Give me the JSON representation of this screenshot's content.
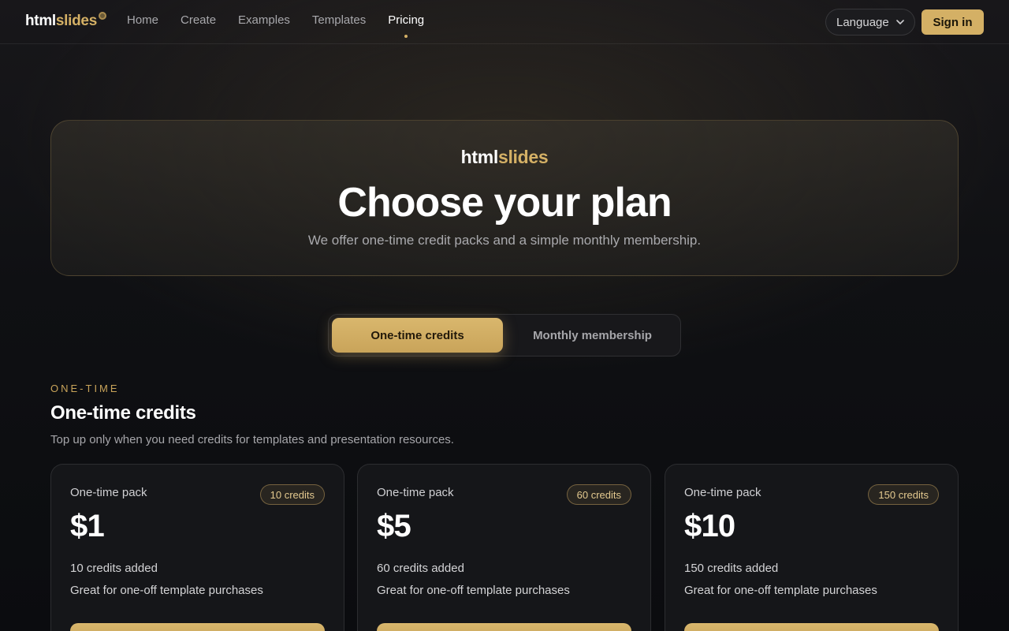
{
  "nav": {
    "brand_a": "html",
    "brand_b": "slides",
    "links": [
      "Home",
      "Create",
      "Examples",
      "Templates",
      "Pricing"
    ],
    "active": "Pricing",
    "language_label": "Language",
    "signin_label": "Sign in"
  },
  "hero": {
    "brand_a": "html",
    "brand_b": "slides",
    "title": "Choose your plan",
    "subtitle": "We offer one-time credit packs and a simple monthly membership."
  },
  "toggle": {
    "options": [
      "One-time credits",
      "Monthly membership"
    ],
    "selected": "One-time credits"
  },
  "section": {
    "eyebrow": "ONE-TIME",
    "title": "One-time credits",
    "subtitle": "Top up only when you need credits for templates and presentation resources."
  },
  "cards": [
    {
      "kind": "One-time pack",
      "badge": "10 credits",
      "price": "$1",
      "line1": "10 credits added",
      "line2": "Great for one-off template purchases"
    },
    {
      "kind": "One-time pack",
      "badge": "60 credits",
      "price": "$5",
      "line1": "60 credits added",
      "line2": "Great for one-off template purchases"
    },
    {
      "kind": "One-time pack",
      "badge": "150 credits",
      "price": "$10",
      "line1": "150 credits added",
      "line2": "Great for one-off template purchases"
    }
  ],
  "colors": {
    "accent": "#d4b065",
    "background": "#0f1013",
    "card": "#151619"
  }
}
